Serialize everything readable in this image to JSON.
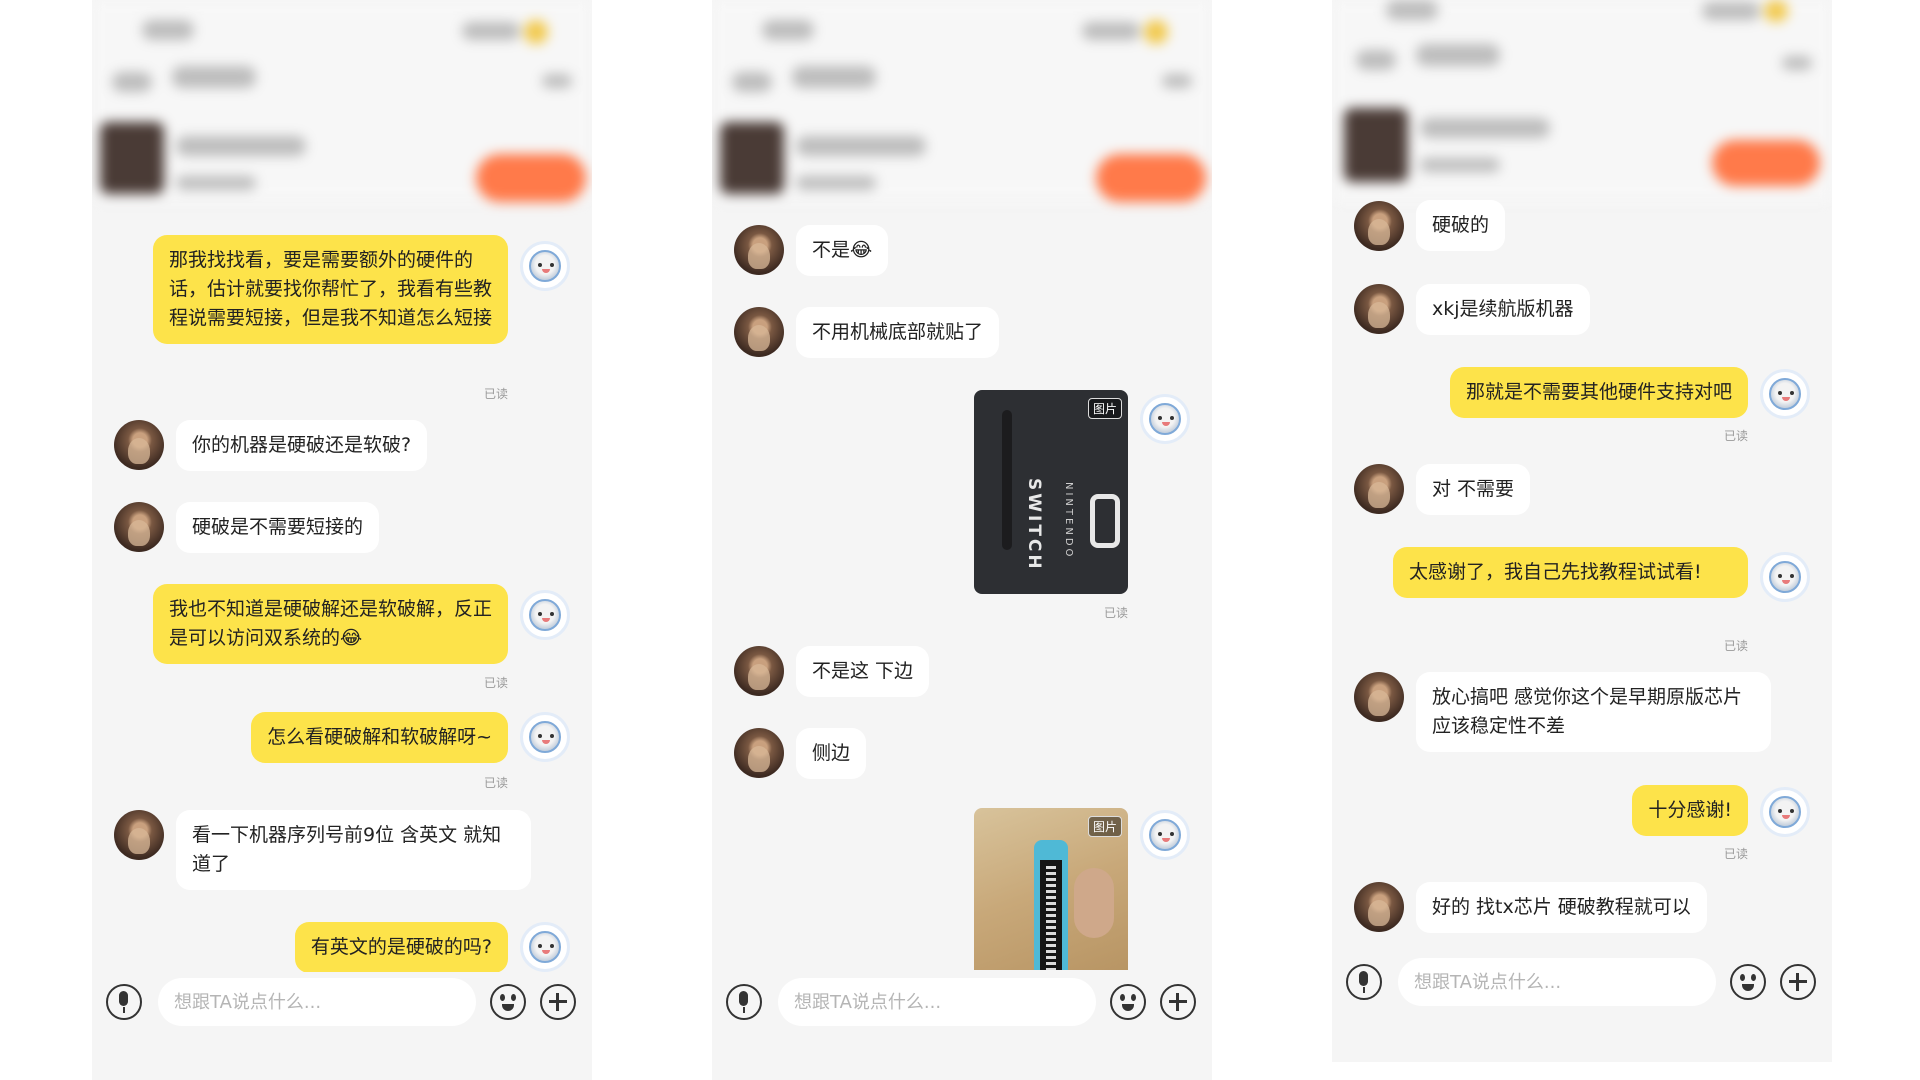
{
  "input": {
    "placeholder": "想跟TA说点什么..."
  },
  "screens": [
    {
      "messages": [
        {
          "from": "me",
          "text": "那我找找看，要是需要额外的硬件的话，估计就要找你帮忙了，我看有些教程说需要短接，但是我不知道怎么短接",
          "status": "已读"
        },
        {
          "from": "peer",
          "text": "你的机器是硬破还是软破?"
        },
        {
          "from": "peer",
          "text": "硬破是不需要短接的"
        },
        {
          "from": "me",
          "text": "我也不知道是硬破解还是软破解，反正是可以访问双系统的😂",
          "status": "已读"
        },
        {
          "from": "me",
          "text": "怎么看硬破解和软破解呀~",
          "status": "已读"
        },
        {
          "from": "peer",
          "text": "看一下机器序列号前9位 含英文 就知道了"
        },
        {
          "from": "me",
          "text": "有英文的是硬破的吗?"
        }
      ]
    },
    {
      "messages": [
        {
          "from": "peer",
          "text": "不是😂"
        },
        {
          "from": "peer",
          "text": "不用机械底部就贴了"
        },
        {
          "from": "me",
          "type": "image",
          "tag": "图片",
          "image_text": "SWITCH",
          "image_subtext": "NINTENDO",
          "status": "已读"
        },
        {
          "from": "peer",
          "text": "不是这 下边"
        },
        {
          "from": "peer",
          "text": "侧边"
        },
        {
          "from": "me",
          "type": "image",
          "tag": "图片"
        }
      ]
    },
    {
      "messages": [
        {
          "from": "peer",
          "text": "硬破的"
        },
        {
          "from": "peer",
          "text": "xkj是续航版机器"
        },
        {
          "from": "me",
          "text": "那就是不需要其他硬件支持对吧",
          "status": "已读"
        },
        {
          "from": "peer",
          "text": "对 不需要"
        },
        {
          "from": "me",
          "text": "太感谢了，我自己先找教程试试看!",
          "status": "已读"
        },
        {
          "from": "peer",
          "text": "放心搞吧 感觉你这个是早期原版芯片 应该稳定性不差"
        },
        {
          "from": "me",
          "text": "十分感谢!",
          "status": "已读"
        },
        {
          "from": "peer",
          "text": "好的 找tx芯片 硬破教程就可以"
        }
      ]
    }
  ]
}
